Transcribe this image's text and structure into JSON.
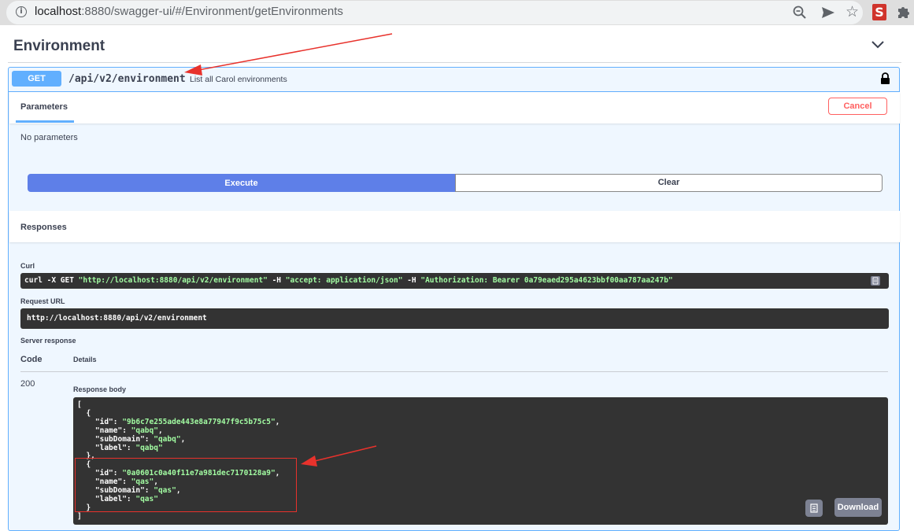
{
  "browser": {
    "url_host": "localhost",
    "url_rest": ":8880/swagger-ui/#/Environment/getEnvironments",
    "extension_label": "S"
  },
  "section": {
    "title": "Environment"
  },
  "operation": {
    "method": "GET",
    "path": "/api/v2/environment",
    "summary": "List all Carol environments"
  },
  "parameters": {
    "tab_label": "Parameters",
    "cancel_label": "Cancel",
    "empty_text": "No parameters"
  },
  "actions": {
    "execute_label": "Execute",
    "clear_label": "Clear"
  },
  "responses": {
    "title": "Responses",
    "curl_label": "Curl",
    "curl_parts": {
      "cmd": "curl -X GET ",
      "url": "\"http://localhost:8880/api/v2/environment\"",
      "h1": " -H  ",
      "accept": "\"accept: application/json\"",
      "h2": " -H  ",
      "auth": "\"Authorization: Bearer 0a79eaed295a4623bbf00aa787aa247b\""
    },
    "request_url_label": "Request URL",
    "request_url": "http://localhost:8880/api/v2/environment",
    "server_response_label": "Server response",
    "code_header": "Code",
    "details_header": "Details",
    "status_code": "200",
    "response_body_label": "Response body",
    "body_items": [
      {
        "id": "9b6c7e255ade443e8a77947f9c5b75c5",
        "name": "qabq",
        "subDomain": "qabq",
        "label": "qabq"
      },
      {
        "id": "0a0601c0a40f11e7a981dec7170128a9",
        "name": "qas",
        "subDomain": "qas",
        "label": "qas"
      }
    ],
    "download_label": "Download"
  },
  "colors": {
    "get_blue": "#61affe",
    "execute_blue": "#5e7fe8",
    "cancel_red": "#ff6060",
    "annotation_red": "#e8322c",
    "code_bg": "#333333",
    "string_green": "#a2fca2"
  }
}
